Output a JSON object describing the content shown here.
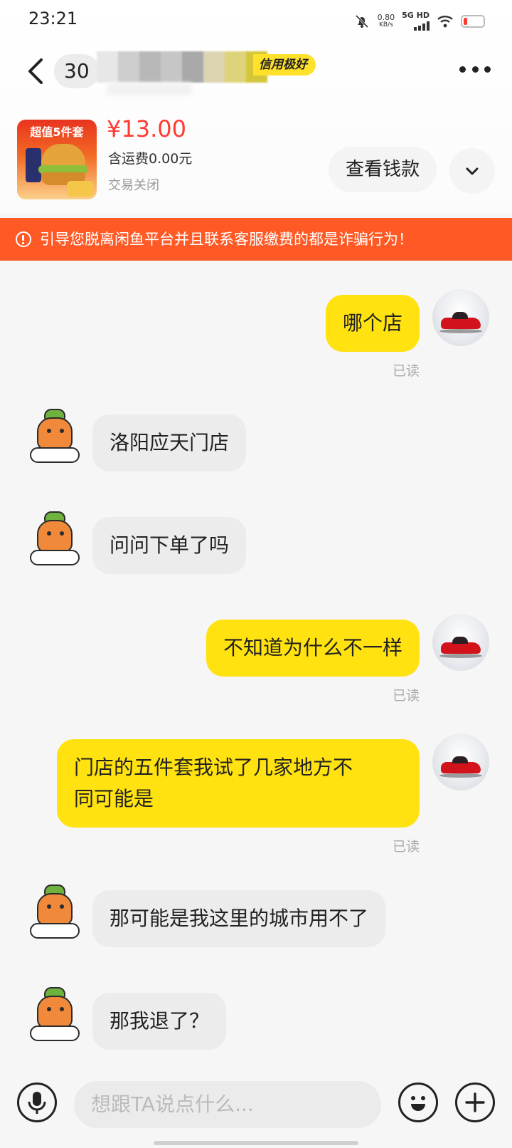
{
  "status_bar": {
    "time": "23:21",
    "net_speed_value": "0.80",
    "net_speed_unit": "KB/s",
    "network": "5G HD"
  },
  "nav": {
    "unread_count": "30",
    "credit_tag": "信用极好"
  },
  "product": {
    "image_label": "超值5件套",
    "price": "¥13.00",
    "shipping": "含运费0.00元",
    "status": "交易关闭",
    "view_money_button": "查看钱款"
  },
  "warning": {
    "text": "引导您脱离闲鱼平台并且联系客服缴费的都是诈骗行为！"
  },
  "messages": [
    {
      "sender": "me",
      "text": "哪个店",
      "read": "已读"
    },
    {
      "sender": "other",
      "text": "洛阳应天门店"
    },
    {
      "sender": "other",
      "text": "问问下单了吗"
    },
    {
      "sender": "me",
      "text": "不知道为什么不一样",
      "read": "已读"
    },
    {
      "sender": "me",
      "text_line1": "门店的五件套我试了几家地方不",
      "text_line2": "同可能是",
      "read": "已读"
    },
    {
      "sender": "other",
      "text": "那可能是我这里的城市用不了"
    },
    {
      "sender": "other",
      "text": "那我退了？"
    }
  ],
  "input": {
    "placeholder": "想跟TA说点什么..."
  },
  "colors": {
    "my_bubble": "#ffe210",
    "other_bubble": "#ececec",
    "warning_bg": "#ff5a26",
    "price": "#ff3b30",
    "credit_tag": "#ffe12b"
  },
  "icons": [
    "back-arrow-icon",
    "more-dots-icon",
    "chevron-down-icon",
    "warning-circle-icon",
    "microphone-icon",
    "emoji-icon",
    "plus-icon",
    "mute-bell-icon",
    "wifi-icon",
    "battery-icon",
    "signal-icon"
  ]
}
